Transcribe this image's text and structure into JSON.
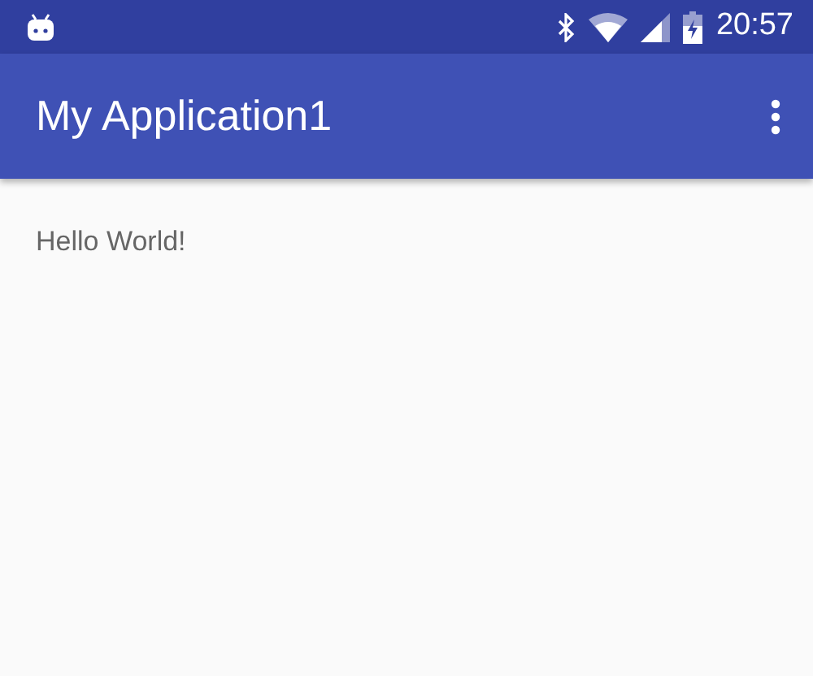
{
  "status_bar": {
    "time": "20:57"
  },
  "app_bar": {
    "title": "My Application1"
  },
  "content": {
    "text": "Hello World!"
  }
}
